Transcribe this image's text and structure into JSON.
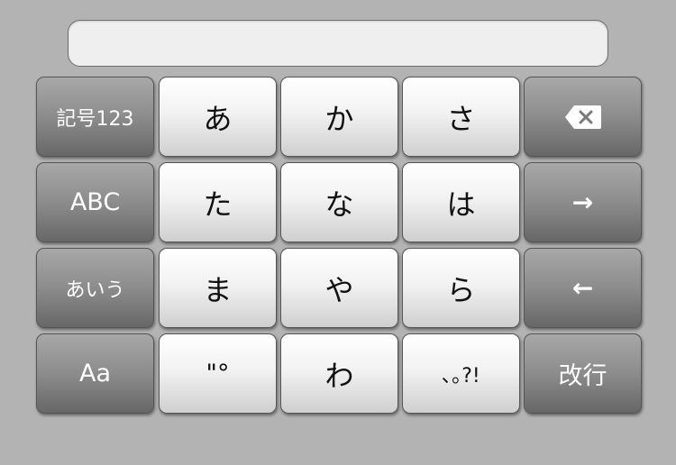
{
  "input": {
    "value": ""
  },
  "keyboard": {
    "rows": [
      [
        {
          "label": "記号123",
          "kind": "mode"
        },
        {
          "label": "あ",
          "kind": "kana"
        },
        {
          "label": "か",
          "kind": "kana"
        },
        {
          "label": "さ",
          "kind": "kana"
        },
        {
          "label": "",
          "kind": "backspace",
          "icon": "backspace-icon"
        }
      ],
      [
        {
          "label": "ABC",
          "kind": "mode"
        },
        {
          "label": "た",
          "kind": "kana"
        },
        {
          "label": "な",
          "kind": "kana"
        },
        {
          "label": "は",
          "kind": "kana"
        },
        {
          "label": "→",
          "kind": "cursor-right"
        }
      ],
      [
        {
          "label": "あいう",
          "kind": "mode"
        },
        {
          "label": "ま",
          "kind": "kana"
        },
        {
          "label": "や",
          "kind": "kana"
        },
        {
          "label": "ら",
          "kind": "kana"
        },
        {
          "label": "←",
          "kind": "cursor-left"
        }
      ],
      [
        {
          "label": "Aa",
          "kind": "case"
        },
        {
          "label": "\"°",
          "kind": "dakuten"
        },
        {
          "label": "わ",
          "kind": "kana"
        },
        {
          "label": "､｡?!",
          "kind": "punctuation"
        },
        {
          "label": "改行",
          "kind": "enter"
        }
      ]
    ]
  },
  "colors": {
    "background": "#b3b3b3",
    "light_key": "#f2f2f2",
    "dark_key": "#8c8c8c"
  }
}
